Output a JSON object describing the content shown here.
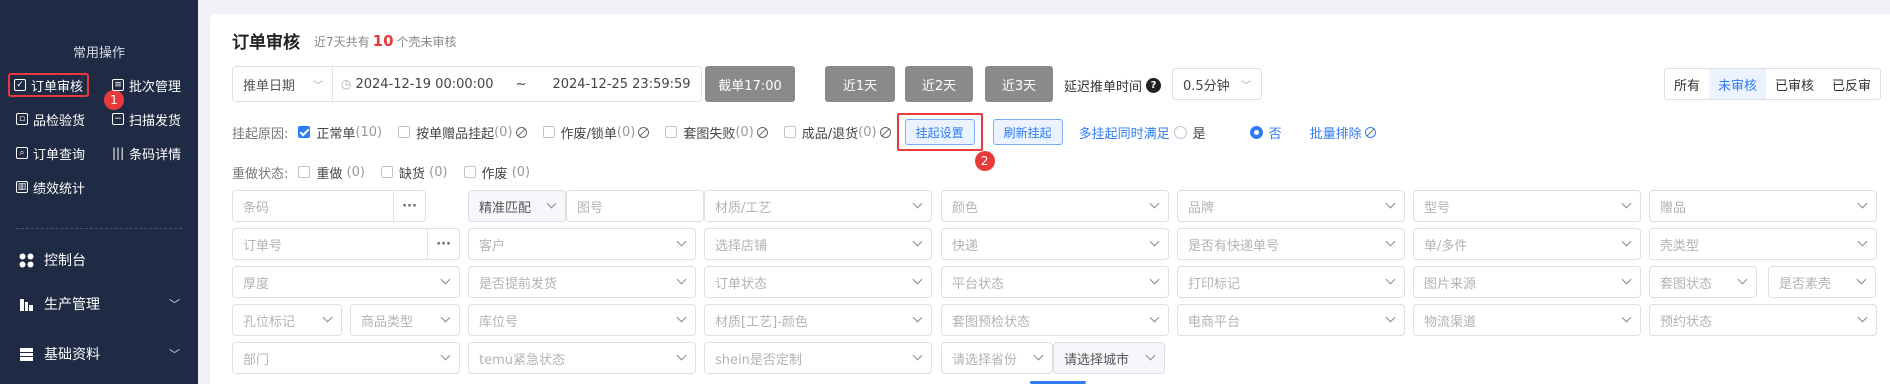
{
  "sidebar": {
    "section_title": "常用操作",
    "quick": [
      {
        "label": "订单审核",
        "icon": "checkbox-icon"
      },
      {
        "label": "批次管理",
        "icon": "list-icon"
      },
      {
        "label": "品检验货",
        "icon": "inspect-icon"
      },
      {
        "label": "扫描发货",
        "icon": "scan-icon"
      },
      {
        "label": "订单查询",
        "icon": "search-doc-icon"
      },
      {
        "label": "条码详情",
        "icon": "barcode-icon"
      },
      {
        "label": "绩效统计",
        "icon": "chart-icon"
      }
    ],
    "badge1": "1",
    "menu": [
      {
        "label": "控制台",
        "icon": "dashboard-icon"
      },
      {
        "label": "生产管理",
        "icon": "production-icon"
      },
      {
        "label": "基础资料",
        "icon": "database-icon"
      }
    ]
  },
  "main": {
    "title": "订单审核",
    "subtitle_pre": "近7天共有",
    "subtitle_num": "10",
    "subtitle_post": "个壳未审核",
    "date_type": "推单日期",
    "date_start": "2024-12-19 00:00:00",
    "date_sep": "~",
    "date_end": "2024-12-25 23:59:59",
    "btn_cutoff": "截单17:00",
    "btn_1day": "近1天",
    "btn_2day": "近2天",
    "btn_3day": "近3天",
    "delay_label": "延迟推单时间",
    "delay_value": "0.5分钟",
    "tabs": [
      "所有",
      "未审核",
      "已审核",
      "已反审"
    ],
    "hold_label": "挂起原因:",
    "hold_items": [
      {
        "label": "正常单",
        "count": "(10)",
        "checked": true
      },
      {
        "label": "按单赠品挂起",
        "count": "(0)"
      },
      {
        "label": "作废/锁单",
        "count": "(0)"
      },
      {
        "label": "套图失败",
        "count": "(0)"
      },
      {
        "label": "成品/退货",
        "count": "(0)"
      }
    ],
    "btn_hold_settings": "挂起设置",
    "badge2": "2",
    "btn_refresh_hold": "刷新挂起",
    "multi_hold_label": "多挂起同时满足",
    "opt_yes": "是",
    "opt_no": "否",
    "batch_exclude": "批量排除",
    "redo_label": "重做状态:",
    "redo_items": [
      {
        "label": "重做",
        "count": "(0)"
      },
      {
        "label": "缺货",
        "count": "(0)"
      },
      {
        "label": "作废",
        "count": "(0)"
      }
    ],
    "filters": {
      "barcode": "条码",
      "match": "精准匹配",
      "pattern_no": "图号",
      "material": "材质/工艺",
      "color": "颜色",
      "brand": "品牌",
      "model": "型号",
      "gift": "赠品",
      "order_no": "订单号",
      "customer": "客户",
      "shop": "选择店铺",
      "express": "快递",
      "has_tracking": "是否有快递单号",
      "single_multi": "单/多件",
      "shell_type": "壳类型",
      "thickness": "厚度",
      "early_ship": "是否提前发货",
      "order_status": "订单状态",
      "platform_status": "平台状态",
      "print_mark": "打印标记",
      "image_source": "图片来源",
      "set_status": "套图状态",
      "plain_shell": "是否素壳",
      "hole_mark": "孔位标记",
      "product_type": "商品类型",
      "location": "库位号",
      "material_color": "材质[工艺]-颜色",
      "precheck": "套图预检状态",
      "ecommerce": "电商平台",
      "logistics": "物流渠道",
      "preorder": "预约状态",
      "dept": "部门",
      "temu": "temu紧急状态",
      "shein": "shein是否定制",
      "province": "请选择省份",
      "city": "请选择城市"
    }
  }
}
